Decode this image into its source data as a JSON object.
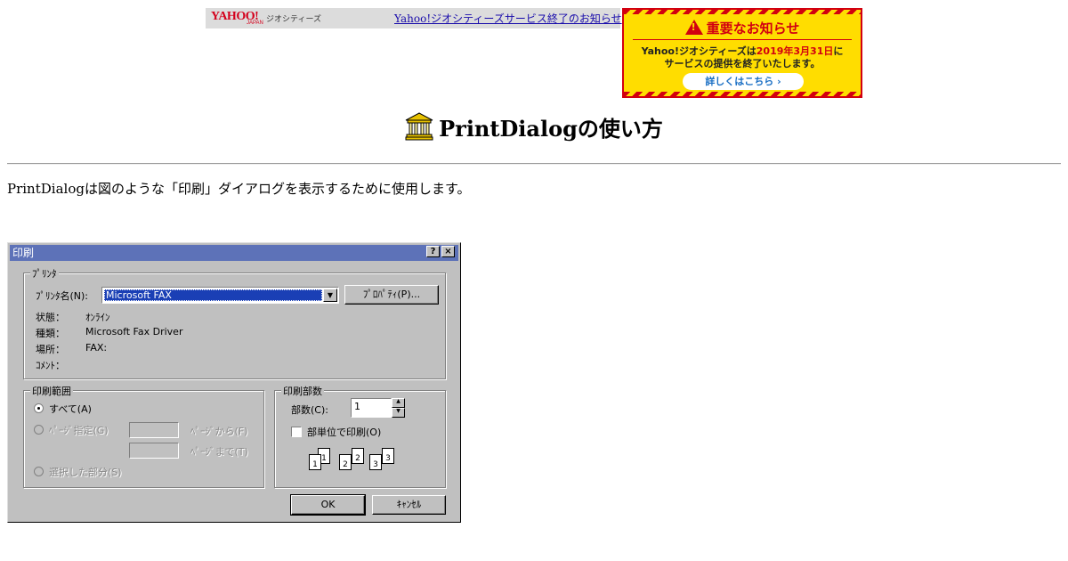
{
  "banner": {
    "logo_text": "YAHOO!",
    "logo_sub": "JAPAN",
    "service_name": "ジオシティーズ",
    "link_text": "Yahoo!ジオシティーズサービス終了のお知らせ"
  },
  "notice_ad": {
    "heading": "重要なお知らせ",
    "line1_prefix": "Yahoo!ジオシティーズは",
    "line1_date": "2019年3月31日",
    "line1_suffix": "に",
    "line2": "サービスの提供を終了いたします。",
    "button_label": "詳しくはこちら ›"
  },
  "page": {
    "title": "PrintDialogの使い方",
    "intro": "PrintDialogは図のような「印刷」ダイアログを表示するために使用します。"
  },
  "dialog": {
    "title": "印刷",
    "help_btn": "?",
    "close_btn": "×",
    "printer_group": {
      "label": "ﾌﾟﾘﾝﾀ",
      "name_label": "ﾌﾟﾘﾝﾀ名(N):",
      "name_value": "Microsoft FAX",
      "properties_button": "ﾌﾟﾛﾊﾟﾃｨ(P)...",
      "status_label": "状態：",
      "status_value": "ｵﾝﾗｲﾝ",
      "type_label": "種類：",
      "type_value": "Microsoft Fax Driver",
      "where_label": "場所：",
      "where_value": "FAX:",
      "comment_label": "ｺﾒﾝﾄ："
    },
    "range_group": {
      "label": "印刷範囲",
      "all_label": "すべて(A)",
      "pages_label": "ﾍﾟｰｼﾞ指定(G)",
      "from_label": "ﾍﾟｰｼﾞから(F)",
      "to_label": "ﾍﾟｰｼﾞまで(T)",
      "selection_label": "選択した部分(S)"
    },
    "copies_group": {
      "label": "印刷部数",
      "copies_label": "部数(C):",
      "copies_value": "1",
      "collate_label": "部単位で印刷(O)",
      "page_numbers": [
        "1",
        "1",
        "2",
        "2",
        "3",
        "3"
      ]
    },
    "ok_button": "OK",
    "cancel_button": "ｷｬﾝｾﾙ"
  },
  "colors": {
    "title_bar": "#5d72b8",
    "dialog_face": "#c0c0c0",
    "notice_bg": "#ffdd00",
    "notice_red": "#d20010",
    "link": "#1a0dab"
  }
}
